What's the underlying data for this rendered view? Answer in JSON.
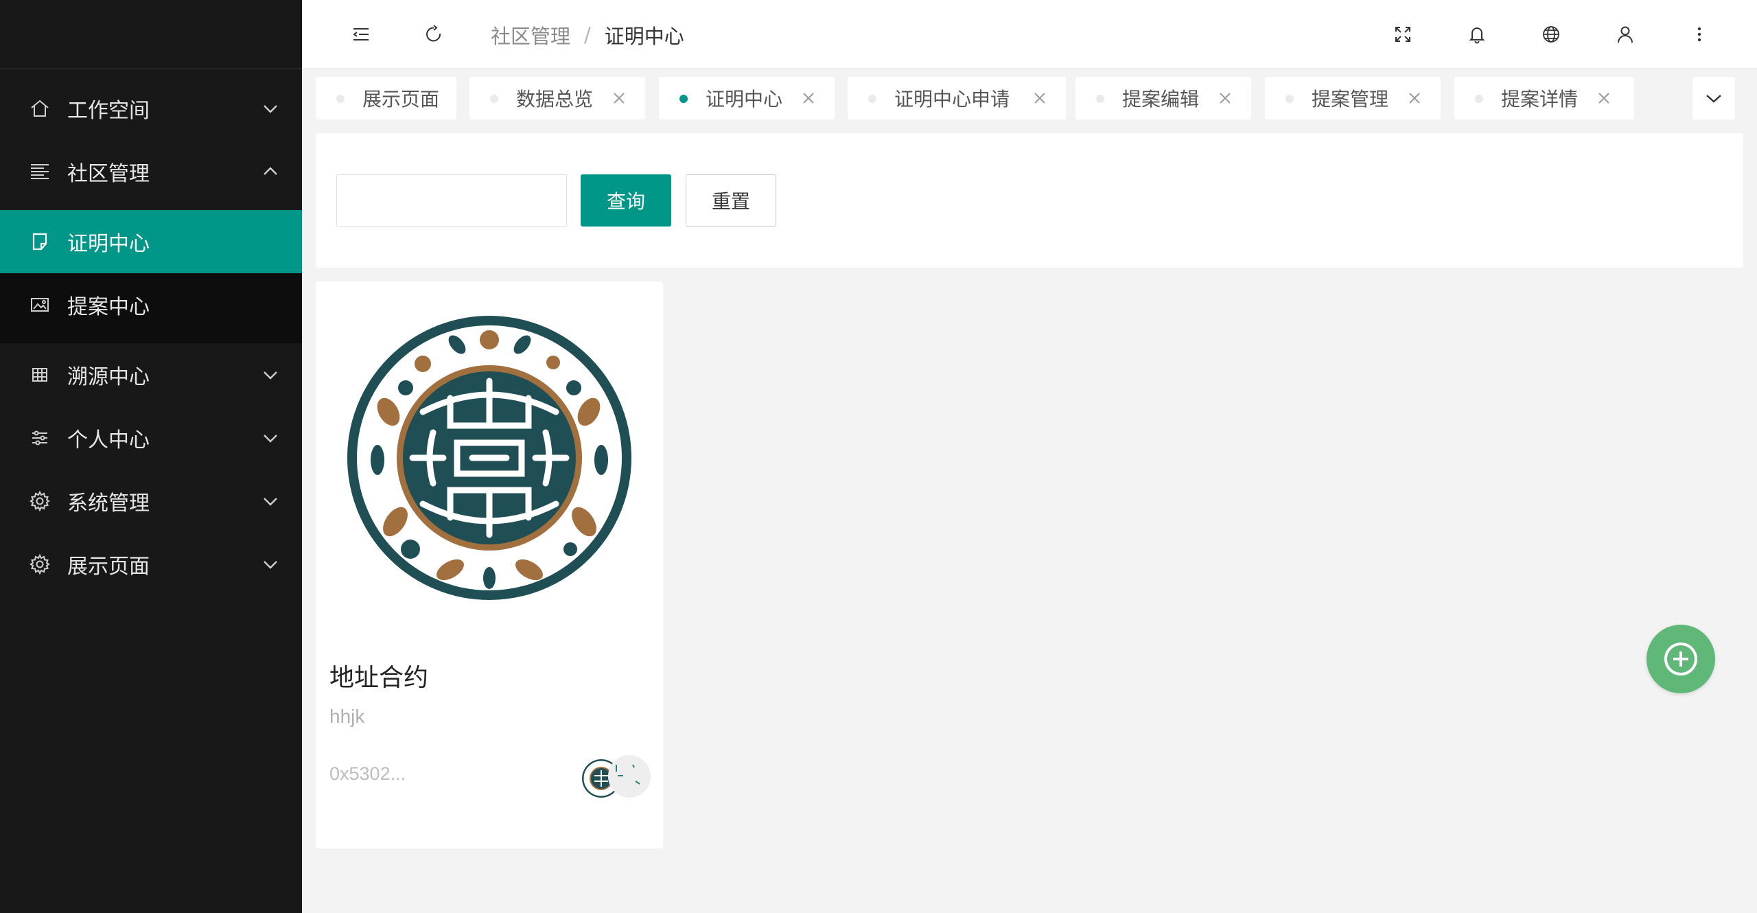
{
  "sidebar": {
    "items": [
      {
        "label": "工作空间",
        "icon": "home-icon"
      },
      {
        "label": "社区管理",
        "icon": "list-icon"
      },
      {
        "label": "证明中心",
        "icon": "document-icon"
      },
      {
        "label": "提案中心",
        "icon": "image-icon"
      },
      {
        "label": "溯源中心",
        "icon": "table-icon"
      },
      {
        "label": "个人中心",
        "icon": "sliders-icon"
      },
      {
        "label": "系统管理",
        "icon": "gear-icon"
      },
      {
        "label": "展示页面",
        "icon": "gear-icon"
      }
    ]
  },
  "header": {
    "breadcrumb": {
      "parent": "社区管理",
      "separator": "/",
      "current": "证明中心"
    }
  },
  "tabs": [
    {
      "label": "展示页面",
      "closable": false,
      "active": false
    },
    {
      "label": "数据总览",
      "closable": true,
      "active": false
    },
    {
      "label": "证明中心",
      "closable": true,
      "active": true
    },
    {
      "label": "证明中心申请",
      "closable": true,
      "active": false
    },
    {
      "label": "提案编辑",
      "closable": true,
      "active": false
    },
    {
      "label": "提案管理",
      "closable": true,
      "active": false
    },
    {
      "label": "提案详情",
      "closable": true,
      "active": false
    }
  ],
  "search": {
    "value": "",
    "query_label": "查询",
    "reset_label": "重置"
  },
  "card": {
    "title": "地址合约",
    "description": "hhjk",
    "address": "0x5302..."
  },
  "colors": {
    "accent": "#009688",
    "sidebar_bg": "#181818",
    "fab": "#5fb878",
    "logo_dark": "#1f4f55",
    "logo_brown": "#a2703e"
  }
}
